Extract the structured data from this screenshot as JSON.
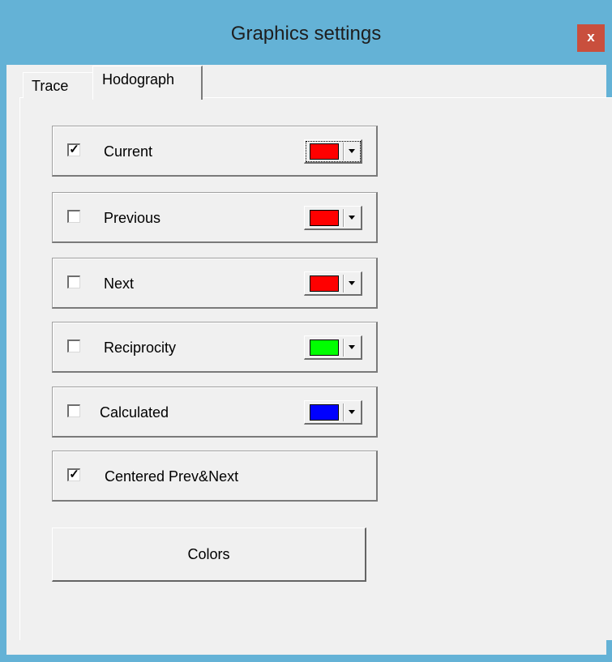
{
  "window": {
    "title": "Graphics settings",
    "close_label": "x"
  },
  "tabs": [
    {
      "label": "Trace",
      "selected": false
    },
    {
      "label": "Hodograph",
      "selected": true
    }
  ],
  "options": [
    {
      "label": "Current",
      "checked": true,
      "color": "#ff0000",
      "has_color": true
    },
    {
      "label": "Previous",
      "checked": false,
      "color": "#ff0000",
      "has_color": true
    },
    {
      "label": "Next",
      "checked": false,
      "color": "#ff0000",
      "has_color": true
    },
    {
      "label": "Reciprocity",
      "checked": false,
      "color": "#00ff00",
      "has_color": true
    },
    {
      "label": "Calculated",
      "checked": false,
      "color": "#0000ff",
      "has_color": true
    },
    {
      "label": "Centered Prev&Next",
      "checked": true,
      "has_color": false
    }
  ],
  "colors_button_label": "Colors"
}
